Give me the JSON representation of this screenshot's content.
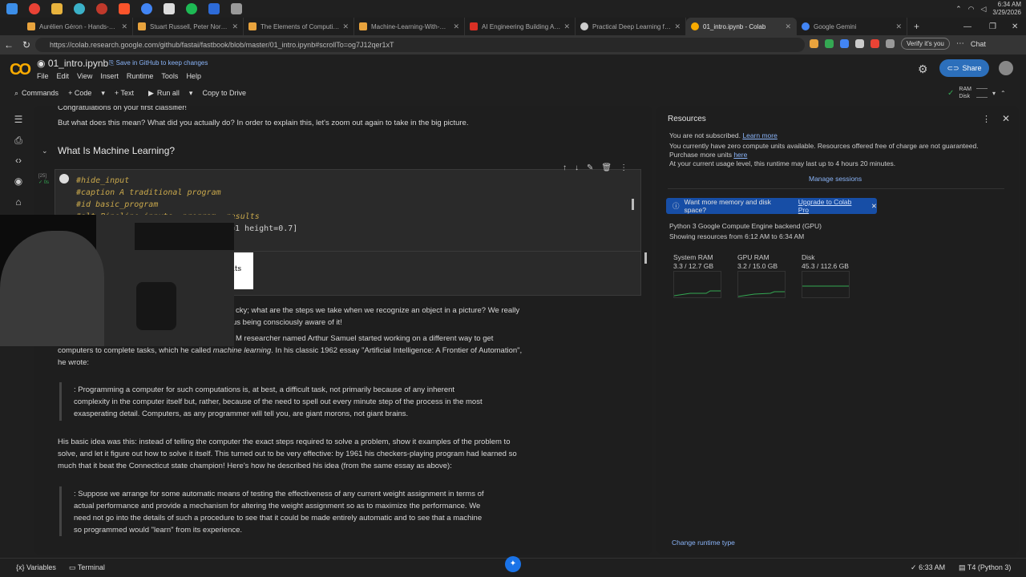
{
  "os": {
    "clock_time": "6:34 AM",
    "clock_date": "3/29/2026"
  },
  "tabs": [
    {
      "label": "Aurélien Géron - Hands-On Mach",
      "color": "#e8a33d"
    },
    {
      "label": "Stuart Russell, Peter Norvig - Artif",
      "color": "#e8a33d"
    },
    {
      "label": "The Elements of Computing Syste",
      "color": "#e8a33d"
    },
    {
      "label": "Machine-Learning-With-PyTorch",
      "color": "#e8a33d"
    },
    {
      "label": "AI Engineering Building Applicatio",
      "color": "#d93025"
    },
    {
      "label": "Practical Deep Learning for Coder",
      "color": "#cccccc"
    },
    {
      "label": "01_intro.ipynb - Colab",
      "color": "#f9ab00"
    },
    {
      "label": "Google Gemini",
      "color": "#4285f4"
    }
  ],
  "browser": {
    "url": "https://colab.research.google.com/github/fastai/fastbook/blob/master/01_intro.ipynb#scrollTo=og7J12qer1xT",
    "verify": "Verify it's you",
    "chat": "Chat"
  },
  "colab": {
    "title": "01_intro.ipynb",
    "save_github": "Save in GitHub to keep changes",
    "menu": [
      "File",
      "Edit",
      "View",
      "Insert",
      "Runtime",
      "Tools",
      "Help"
    ],
    "share": "Share",
    "toolbar": {
      "commands": "Commands",
      "code": "+ Code",
      "text": "+ Text",
      "run_all": "Run all",
      "copy_drive": "Copy to Drive"
    },
    "ram_label": "RAM",
    "disk_label": "Disk"
  },
  "notebook": {
    "para_top_partial": "Congratulations on your first classifier!",
    "para1": "But what does this mean? What did you actually do? In order to explain this, let's zoom out again to take in the big picture.",
    "heading": "What Is Machine Learning?",
    "exec_count": "[25]",
    "exec_time": "0s",
    "code_lines": [
      "#hide_input",
      "#caption A traditional program",
      "#id basic_program",
      "#alt Pipeline inputs, program, results",
      "gv('''program[shape=box3d width=1 height=0.7]"
    ],
    "code_line4_visible": "#alt Pipeline inputs, program, results",
    "code_line5_visible": "=1 height=0.7]",
    "output_text": "lts",
    "para2_line1": "cky; what are the steps we take when we recognize an object in a picture? We really",
    "para2_line2": "us being consciously aware of it!",
    "para3_line1": "M researcher named Arthur Samuel started working on a different way to get",
    "para3_line2a": "computers to complete tasks, which he called ",
    "para3_em": "machine learning",
    "para3_line2b": ". In his classic 1962 essay \"Artificial Intelligence: A Frontier of Automation\",",
    "para3_line3": "he wrote:",
    "quote1": [
      ": Programming a computer for such computations is, at best, a difficult task, not primarily because of any inherent",
      "complexity in the computer itself but, rather, because of the need to spell out every minute step of the process in the most",
      "exasperating detail. Computers, as any programmer will tell you, are giant morons, not giant brains."
    ],
    "para4": [
      "His basic idea was this: instead of telling the computer the exact steps required to solve a problem, show it examples of the problem to",
      "solve, and let it figure out how to solve it itself. This turned out to be very effective: by 1961 his checkers-playing program had learned so",
      "much that it beat the Connecticut state champion! Here's how he described his idea (from the same essay as above):"
    ],
    "quote2": [
      ": Suppose we arrange for some automatic means of testing the effectiveness of any current weight assignment in terms of",
      "actual performance and provide a mechanism for altering the weight assignment so as to maximize the performance. We",
      "need not go into the details of such a procedure to see that it could be made entirely automatic and to see that a machine",
      "so programmed would \"learn\" from its experience."
    ]
  },
  "resources": {
    "title": "Resources",
    "not_subscribed": "You are not subscribed.",
    "learn_more": "Learn more",
    "units": "You currently have zero compute units available. Resources offered free of charge are not guaranteed.",
    "purchase": "Purchase more units ",
    "here": "here",
    "usage": "At your current usage level, this runtime may last up to 4 hours 20 minutes.",
    "manage": "Manage sessions",
    "upgrade_q": "Want more memory and disk space?",
    "upgrade_link": "Upgrade to Colab Pro",
    "backend": "Python 3 Google Compute Engine backend (GPU)",
    "showing": "Showing resources from 6:12 AM to 6:34 AM",
    "metrics": [
      {
        "name": "System RAM",
        "value": "3.3 / 12.7 GB"
      },
      {
        "name": "GPU RAM",
        "value": "3.2 / 15.0 GB"
      },
      {
        "name": "Disk",
        "value": "45.3 / 112.6 GB"
      }
    ],
    "change_runtime": "Change runtime type"
  },
  "statusbar": {
    "variables": "Variables",
    "terminal": "Terminal",
    "time": "6:33 AM",
    "runtime": "T4 (Python 3)"
  },
  "colors": {
    "accent": "#8ab4f8",
    "share": "#2c6fbb",
    "upgrade_bg": "#174ea6",
    "code": "#c9a84c",
    "spark": "#34a853"
  }
}
